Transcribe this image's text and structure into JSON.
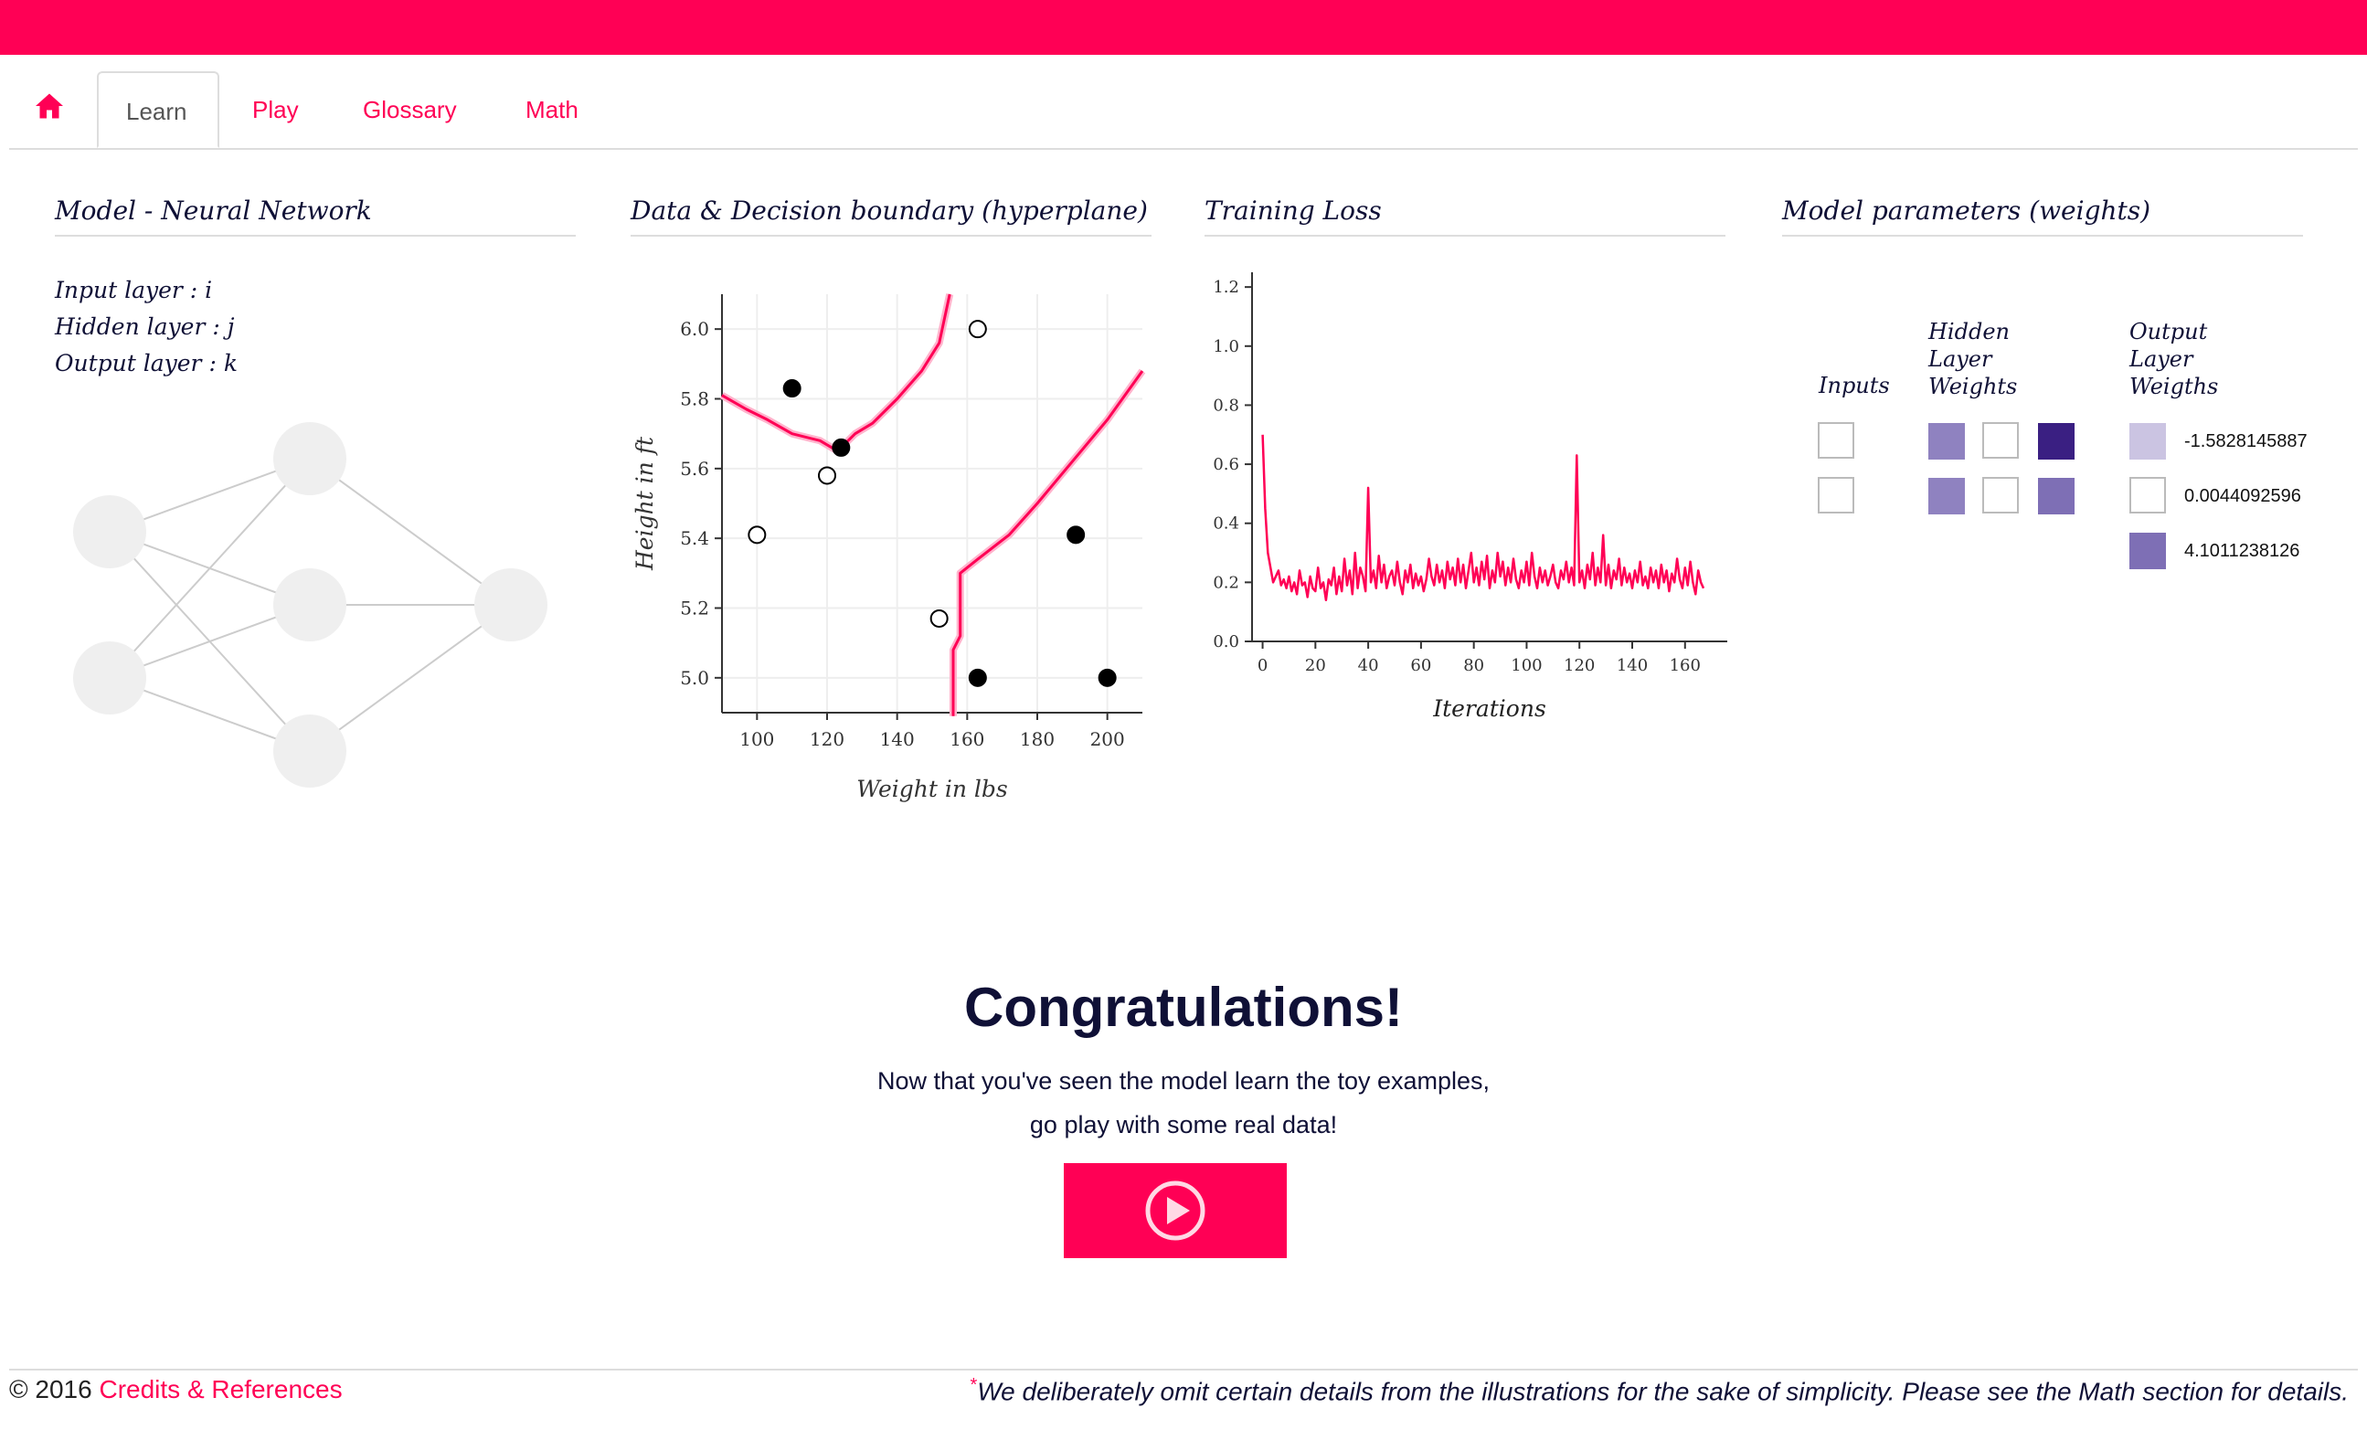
{
  "nav": {
    "home_icon": "home-icon",
    "tabs": [
      {
        "label": "Learn",
        "active": true
      },
      {
        "label": "Play",
        "active": false
      },
      {
        "label": "Glossary",
        "active": false
      },
      {
        "label": "Math",
        "active": false
      }
    ]
  },
  "colors": {
    "accent": "#ff0055",
    "text": "#0f1036",
    "weight_dark": "#3a1f82",
    "weight_mid": "#8f82c0",
    "weight_light": "#cbc4e2"
  },
  "panels": {
    "model": {
      "title": "Model - Neural Network",
      "layers": [
        "Input layer : i",
        "Hidden layer : j",
        "Output layer : k"
      ]
    },
    "data": {
      "title": "Data & Decision boundary (hyperplane)"
    },
    "loss": {
      "title": "Training Loss"
    },
    "weights": {
      "title": "Model parameters (weights)",
      "col_inputs": "Inputs",
      "col_hidden": [
        "Hidden",
        "Layer",
        "Weights"
      ],
      "col_output": [
        "Output",
        "Layer",
        "Weigths"
      ],
      "output_values": [
        "-1.5828145887",
        "0.0044092596",
        "4.1011238126"
      ]
    }
  },
  "chart_data": [
    {
      "type": "scatter",
      "xlabel": "Weight in lbs",
      "ylabel": "Height in ft",
      "xlim": [
        90,
        210
      ],
      "ylim": [
        4.9,
        6.1
      ],
      "xticks": [
        "100",
        "120",
        "140",
        "160",
        "180",
        "200"
      ],
      "yticks": [
        "5.0",
        "5.2",
        "5.4",
        "5.6",
        "5.8",
        "6.0"
      ],
      "grid": true,
      "series": [
        {
          "points": [
            [
              110,
              5.83
            ],
            [
              124,
              5.66
            ],
            [
              163,
              5.0
            ],
            [
              191,
              5.41
            ],
            [
              200,
              5.0
            ]
          ],
          "filled": true
        },
        {
          "points": [
            [
              100,
              5.41
            ],
            [
              120,
              5.58
            ],
            [
              152,
              5.17
            ],
            [
              163,
              6.0
            ]
          ],
          "filled": false
        }
      ],
      "boundary": [
        [
          [
            90,
            5.81
          ],
          [
            97,
            5.77
          ],
          [
            103,
            5.74
          ],
          [
            110,
            5.7
          ],
          [
            118,
            5.68
          ],
          [
            123,
            5.65
          ],
          [
            128,
            5.7
          ],
          [
            133,
            5.73
          ],
          [
            140,
            5.8
          ],
          [
            147,
            5.88
          ],
          [
            152,
            5.96
          ],
          [
            155,
            6.1
          ]
        ],
        [
          [
            156,
            4.89
          ],
          [
            156,
            5.08
          ],
          [
            158,
            5.12
          ],
          [
            158,
            5.2
          ],
          [
            158,
            5.3
          ],
          [
            163,
            5.34
          ],
          [
            172,
            5.41
          ],
          [
            180,
            5.5
          ],
          [
            190,
            5.62
          ],
          [
            200,
            5.74
          ],
          [
            210,
            5.88
          ]
        ]
      ]
    },
    {
      "type": "line",
      "xlabel": "Iterations",
      "ylabel": "",
      "xlim": [
        -4,
        176
      ],
      "ylim": [
        0,
        1.25
      ],
      "xticks": [
        "0",
        "20",
        "40",
        "60",
        "80",
        "100",
        "120",
        "140",
        "160"
      ],
      "yticks": [
        "0.0",
        "0.2",
        "0.4",
        "0.6",
        "0.8",
        "1.0",
        "1.2"
      ],
      "series": [
        {
          "values": [
            0.7,
            0.45,
            0.3,
            0.25,
            0.2,
            0.22,
            0.24,
            0.19,
            0.21,
            0.18,
            0.22,
            0.17,
            0.2,
            0.16,
            0.24,
            0.19,
            0.2,
            0.15,
            0.22,
            0.18,
            0.17,
            0.25,
            0.18,
            0.2,
            0.14,
            0.21,
            0.19,
            0.25,
            0.16,
            0.22,
            0.17,
            0.28,
            0.19,
            0.24,
            0.16,
            0.3,
            0.18,
            0.25,
            0.22,
            0.17,
            0.52,
            0.2,
            0.24,
            0.18,
            0.29,
            0.2,
            0.26,
            0.18,
            0.22,
            0.24,
            0.19,
            0.27,
            0.2,
            0.16,
            0.24,
            0.2,
            0.26,
            0.18,
            0.23,
            0.19,
            0.22,
            0.17,
            0.21,
            0.28,
            0.22,
            0.19,
            0.26,
            0.2,
            0.24,
            0.18,
            0.27,
            0.21,
            0.25,
            0.19,
            0.28,
            0.2,
            0.26,
            0.18,
            0.24,
            0.3,
            0.2,
            0.25,
            0.19,
            0.27,
            0.21,
            0.29,
            0.18,
            0.24,
            0.2,
            0.3,
            0.22,
            0.27,
            0.19,
            0.25,
            0.2,
            0.28,
            0.21,
            0.18,
            0.24,
            0.2,
            0.27,
            0.19,
            0.3,
            0.22,
            0.18,
            0.25,
            0.2,
            0.24,
            0.19,
            0.22,
            0.26,
            0.2,
            0.18,
            0.24,
            0.21,
            0.27,
            0.2,
            0.25,
            0.19,
            0.63,
            0.2,
            0.24,
            0.18,
            0.26,
            0.21,
            0.3,
            0.19,
            0.25,
            0.2,
            0.36,
            0.19,
            0.26,
            0.18,
            0.24,
            0.21,
            0.28,
            0.19,
            0.25,
            0.2,
            0.23,
            0.18,
            0.24,
            0.2,
            0.27,
            0.19,
            0.22,
            0.18,
            0.25,
            0.2,
            0.24,
            0.18,
            0.26,
            0.2,
            0.24,
            0.17,
            0.23,
            0.2,
            0.28,
            0.21,
            0.18,
            0.25,
            0.19,
            0.27,
            0.2,
            0.16,
            0.24,
            0.2,
            0.18
          ]
        }
      ]
    }
  ],
  "congrats": {
    "title": "Congratulations!",
    "line1": "Now that you've seen the model learn the toy examples,",
    "line2": "go play with some real data!",
    "play_icon": "play-circle-icon"
  },
  "footer": {
    "copyright": "© 2016",
    "credits_link": "Credits & References",
    "note_star": "*",
    "note": "We deliberately omit certain details from the illustrations for the sake of simplicity. Please see the Math section for details."
  }
}
